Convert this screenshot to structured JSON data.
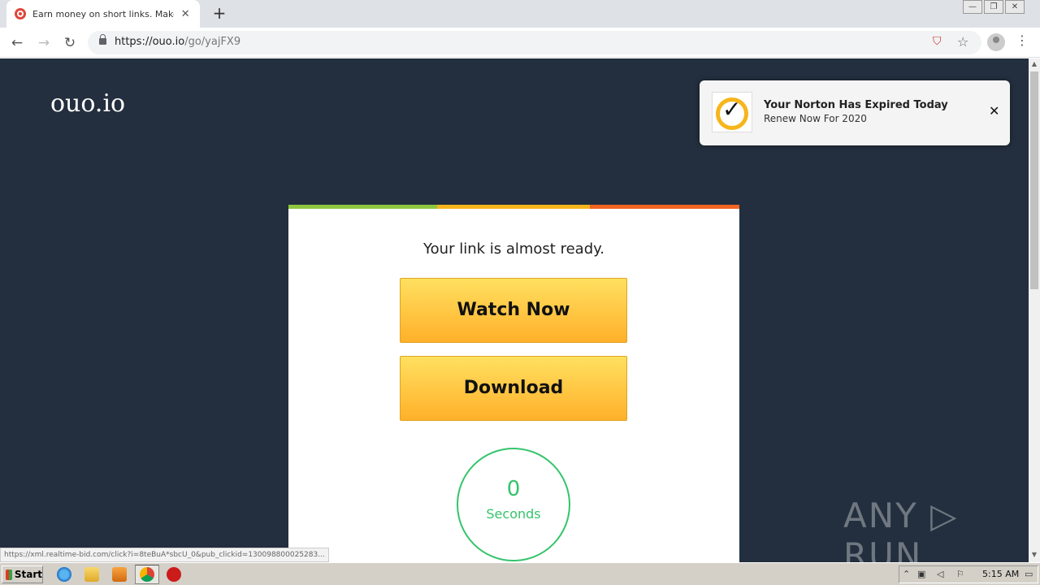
{
  "browser": {
    "tab_title": "Earn money on short links. Make sho",
    "tab_close": "✕",
    "new_tab": "+",
    "url_host": "https://ouo.io",
    "url_path": "/go/yajFX9",
    "back": "←",
    "forward": "→",
    "reload": "↻",
    "shield": "⛉",
    "star": "☆",
    "menu": "⋮",
    "win_minimize": "—",
    "win_restore": "❐",
    "win_close": "✕"
  },
  "site": {
    "logo": "ouo.io"
  },
  "card": {
    "headline": "Your link is almost ready.",
    "watch_label": "Watch Now",
    "download_label": "Download",
    "timer_value": "0",
    "timer_unit": "Seconds",
    "bar_colors": [
      "#8dc63f",
      "#f7b51c",
      "#f26522"
    ]
  },
  "notification": {
    "title": "Your Norton Has Expired Today",
    "subtitle": "Renew Now For 2020",
    "check": "✓",
    "close": "✕"
  },
  "status_url": "https://xml.realtime-bid.com/click?i=8teBuA*sbcU_0&pub_clickid=130098800025283...",
  "watermark": "ANY ▷ RUN",
  "taskbar": {
    "start_label": "Start",
    "clock": "5:15 AM"
  },
  "colors": {
    "page_bg": "#232f3e",
    "cta": "#ffc840",
    "timer": "#35c46b"
  }
}
